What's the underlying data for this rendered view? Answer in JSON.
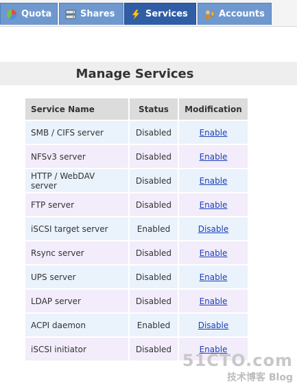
{
  "tabs": [
    {
      "label": "Quota",
      "icon": "quota-icon"
    },
    {
      "label": "Shares",
      "icon": "shares-icon"
    },
    {
      "label": "Services",
      "icon": "lightning-icon",
      "active": true
    },
    {
      "label": "Accounts",
      "icon": "accounts-icon"
    }
  ],
  "page": {
    "title": "Manage Services"
  },
  "table": {
    "headers": [
      "Service Name",
      "Status",
      "Modification"
    ],
    "rows": [
      {
        "name": "SMB / CIFS server",
        "status": "Disabled",
        "action": "Enable"
      },
      {
        "name": "NFSv3 server",
        "status": "Disabled",
        "action": "Enable"
      },
      {
        "name": "HTTP / WebDAV server",
        "status": "Disabled",
        "action": "Enable"
      },
      {
        "name": "FTP server",
        "status": "Disabled",
        "action": "Enable"
      },
      {
        "name": "iSCSI target server",
        "status": "Enabled",
        "action": "Disable"
      },
      {
        "name": "Rsync server",
        "status": "Disabled",
        "action": "Enable"
      },
      {
        "name": "UPS server",
        "status": "Disabled",
        "action": "Enable"
      },
      {
        "name": "LDAP server",
        "status": "Disabled",
        "action": "Enable"
      },
      {
        "name": "ACPI daemon",
        "status": "Enabled",
        "action": "Disable"
      },
      {
        "name": "iSCSI initiator",
        "status": "Disabled",
        "action": "Enable"
      }
    ]
  },
  "watermark": {
    "site": "51CTO.com",
    "sub": "技术博客 Blog"
  },
  "colors": {
    "tab": "#6f98cf",
    "tab_active": "#2f5da6",
    "link": "#1a3fb5",
    "row_odd": "#eaf2fc",
    "row_even": "#f3ecfb"
  }
}
